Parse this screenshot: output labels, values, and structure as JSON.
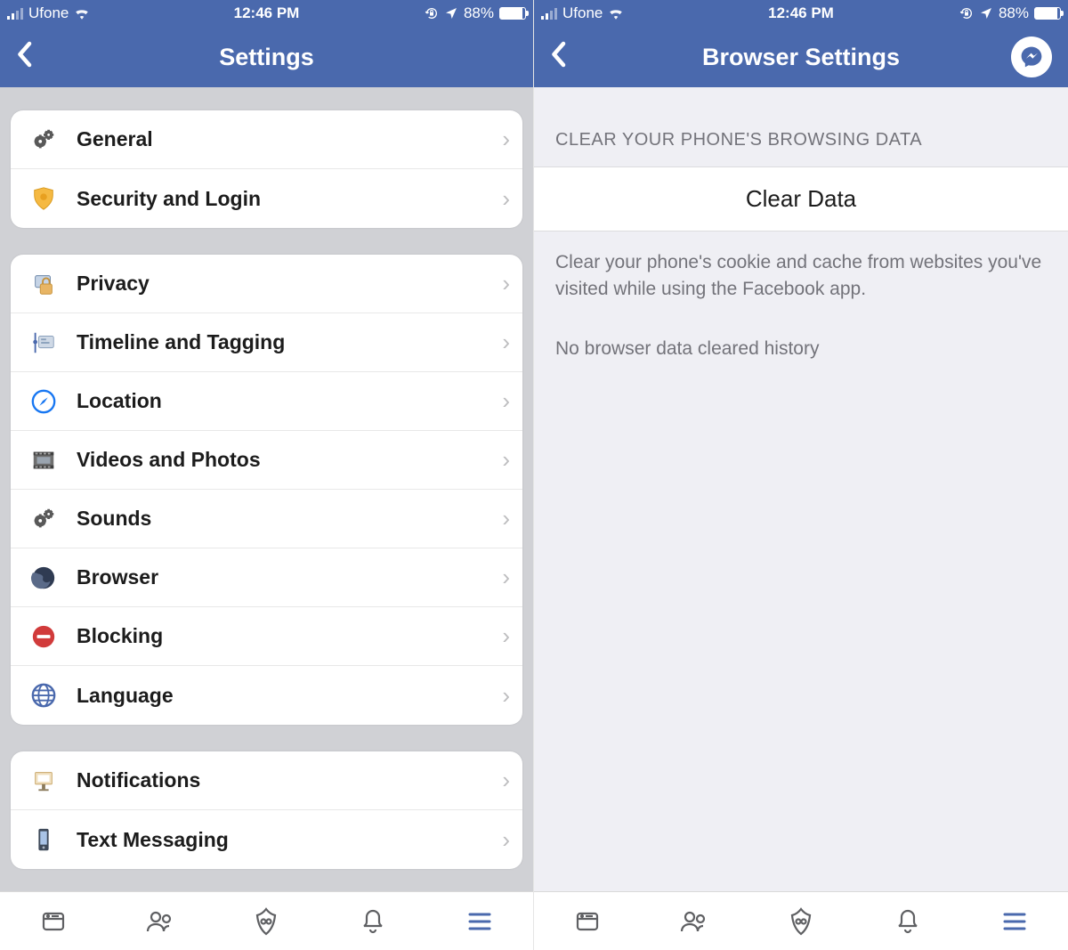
{
  "status": {
    "carrier": "Ufone",
    "time": "12:46 PM",
    "battery_pct": "88%"
  },
  "left": {
    "title": "Settings",
    "groups": [
      {
        "items": [
          {
            "label": "General",
            "icon": "gears"
          },
          {
            "label": "Security and Login",
            "icon": "shield-badge"
          }
        ]
      },
      {
        "items": [
          {
            "label": "Privacy",
            "icon": "privacy-lock"
          },
          {
            "label": "Timeline and Tagging",
            "icon": "timeline"
          },
          {
            "label": "Location",
            "icon": "compass"
          },
          {
            "label": "Videos and Photos",
            "icon": "film"
          },
          {
            "label": "Sounds",
            "icon": "gears"
          },
          {
            "label": "Browser",
            "icon": "globe-dark"
          },
          {
            "label": "Blocking",
            "icon": "block"
          },
          {
            "label": "Language",
            "icon": "globe-grid"
          }
        ]
      },
      {
        "items": [
          {
            "label": "Notifications",
            "icon": "board"
          },
          {
            "label": "Text Messaging",
            "icon": "sms-phone"
          }
        ]
      }
    ]
  },
  "right": {
    "title": "Browser Settings",
    "section_header": "CLEAR YOUR PHONE'S BROWSING DATA",
    "clear_label": "Clear Data",
    "desc1": "Clear your phone's cookie and cache from websites you've visited while using the Facebook app.",
    "desc2": "No browser data cleared history"
  }
}
